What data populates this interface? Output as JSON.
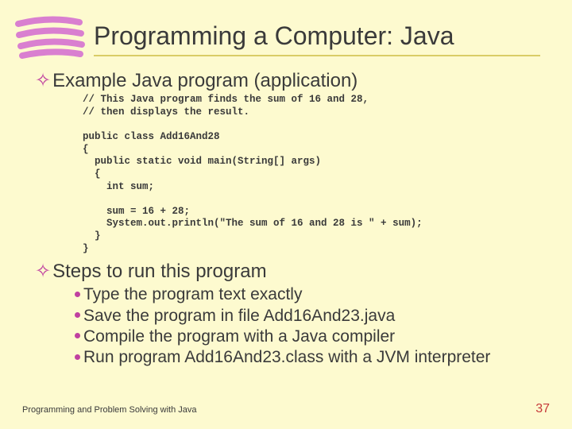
{
  "title": "Programming a Computer: Java",
  "section1": "Example Java program (application)",
  "code": "// This Java program finds the sum of 16 and 28,\n// then displays the result.\n\npublic class Add16And28\n{\n  public static void main(String[] args)\n  {\n    int sum;\n\n    sum = 16 + 28;\n    System.out.println(\"The sum of 16 and 28 is \" + sum);\n  }\n}",
  "section2": "Steps to run this program",
  "steps": [
    "Type the program text exactly",
    "Save the program in file Add16And23.java",
    "Compile the program with a Java compiler",
    "Run program Add16And23.class with a JVM interpreter"
  ],
  "footer": "Programming and Problem Solving with Java",
  "page": "37"
}
